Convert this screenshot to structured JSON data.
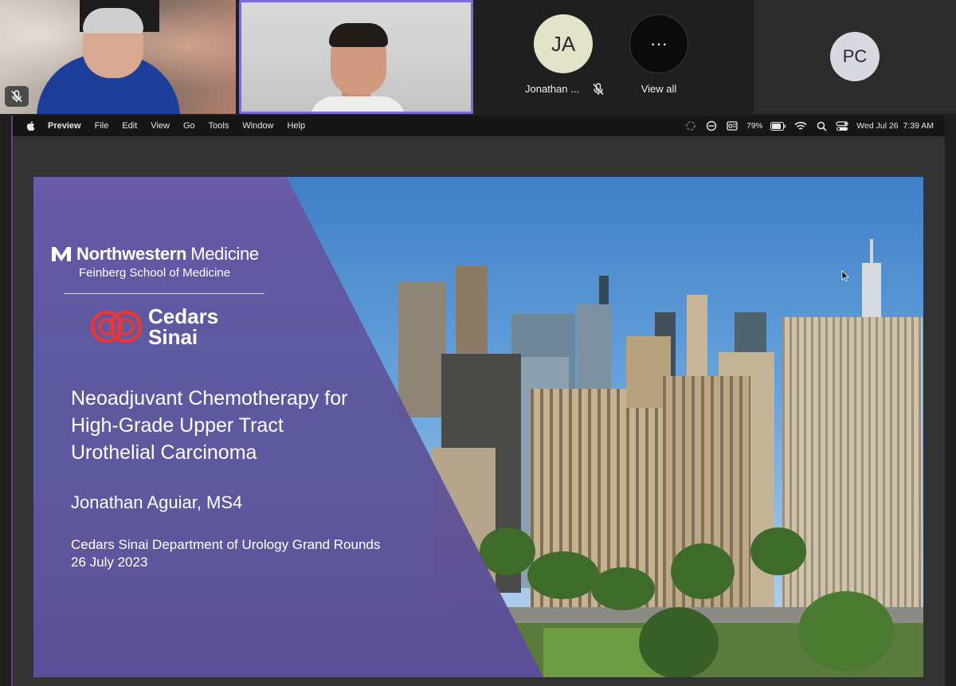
{
  "participants": {
    "tile_ja": {
      "initials": "JA",
      "name": "Jonathan ..."
    },
    "view_all": {
      "glyph": "···",
      "label": "View all"
    },
    "tile_pc": {
      "initials": "PC"
    }
  },
  "menubar": {
    "app_name": "Preview",
    "items": [
      "File",
      "Edit",
      "View",
      "Go",
      "Tools",
      "Window",
      "Help"
    ],
    "battery": "79%",
    "datetime": "Wed Jul 26  7:39 AM"
  },
  "slide": {
    "logo_primary": "Northwestern",
    "logo_primary_suffix": "Medicine",
    "logo_secondary": "Feinberg School of Medicine",
    "partner_line1": "Cedars",
    "partner_line2": "Sinai",
    "title_lines": [
      "Neoadjuvant Chemotherapy for",
      "High-Grade Upper Tract",
      "Urothelial Carcinoma"
    ],
    "author": "Jonathan Aguiar, MS4",
    "event": "Cedars Sinai Department of Urology Grand Rounds",
    "date": "26 July 2023"
  },
  "colors": {
    "active_speaker_border": "#7c6cd6",
    "slide_overlay": "#5a4e96",
    "partner_red": "#e03a3e"
  }
}
